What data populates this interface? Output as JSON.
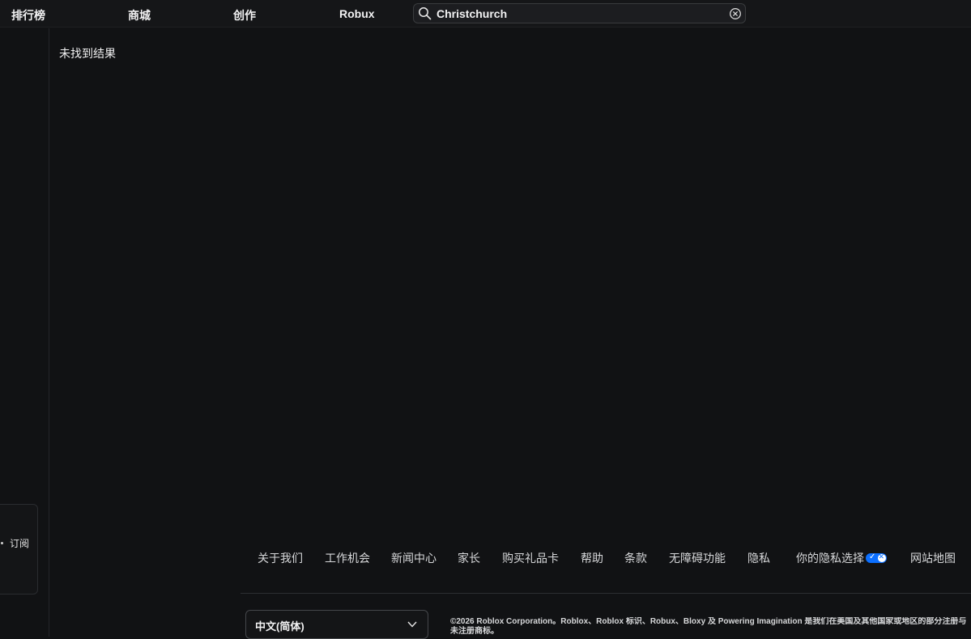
{
  "nav": {
    "items": [
      {
        "label": "排行榜"
      },
      {
        "label": "商城"
      },
      {
        "label": "创作"
      },
      {
        "label": "Robux"
      }
    ]
  },
  "search": {
    "value": "Christchurch",
    "icon": "search-icon",
    "clear_icon": "clear-circle-icon"
  },
  "sidebar": {
    "subscribe_label": "订阅"
  },
  "main": {
    "no_results_text": "未找到结果"
  },
  "footer": {
    "links": [
      {
        "label": "关于我们"
      },
      {
        "label": "工作机会"
      },
      {
        "label": "新闻中心"
      },
      {
        "label": "家长"
      },
      {
        "label": "购买礼品卡"
      },
      {
        "label": "帮助"
      },
      {
        "label": "条款"
      },
      {
        "label": "无障碍功能"
      },
      {
        "label": "隐私"
      },
      {
        "label": "你的隐私选择"
      },
      {
        "label": "网站地图"
      }
    ],
    "privacy_badge_color": "#0b6fff",
    "language": {
      "selected": "中文(简体)",
      "icon": "chevron-down-icon"
    },
    "copyright": "©2026 Roblox Corporation。Roblox、Roblox 标识、Robux、Bloxy 及 Powering Imagination 是我们在美国及其他国家或地区的部分注册与未注册商标。"
  },
  "colors": {
    "background": "#111214",
    "topbar": "#151618",
    "text": "#f2f2f3"
  }
}
